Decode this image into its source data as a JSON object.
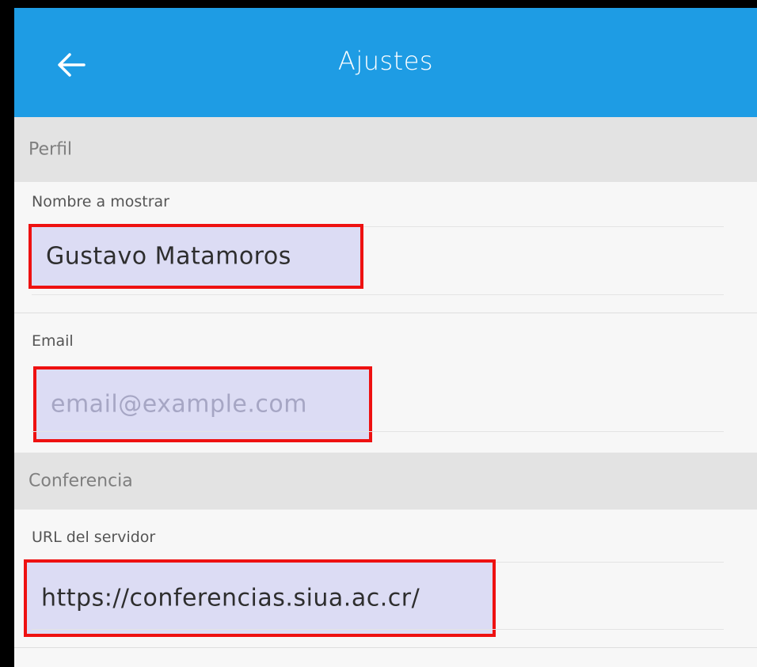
{
  "appbar": {
    "title": "Ajustes",
    "back_icon": "arrow-left-icon",
    "background_color": "#1e9ce4"
  },
  "sections": {
    "profile": {
      "header": "Perfil",
      "display_name": {
        "label": "Nombre a mostrar",
        "value": "Gustavo Matamoros"
      },
      "email": {
        "label": "Email",
        "value": "",
        "placeholder": "email@example.com"
      }
    },
    "conference": {
      "header": "Conferencia",
      "server_url": {
        "label": "URL del servidor",
        "value": "https://conferencias.siua.ac.cr/"
      }
    }
  },
  "highlight_color": "#ee1111"
}
